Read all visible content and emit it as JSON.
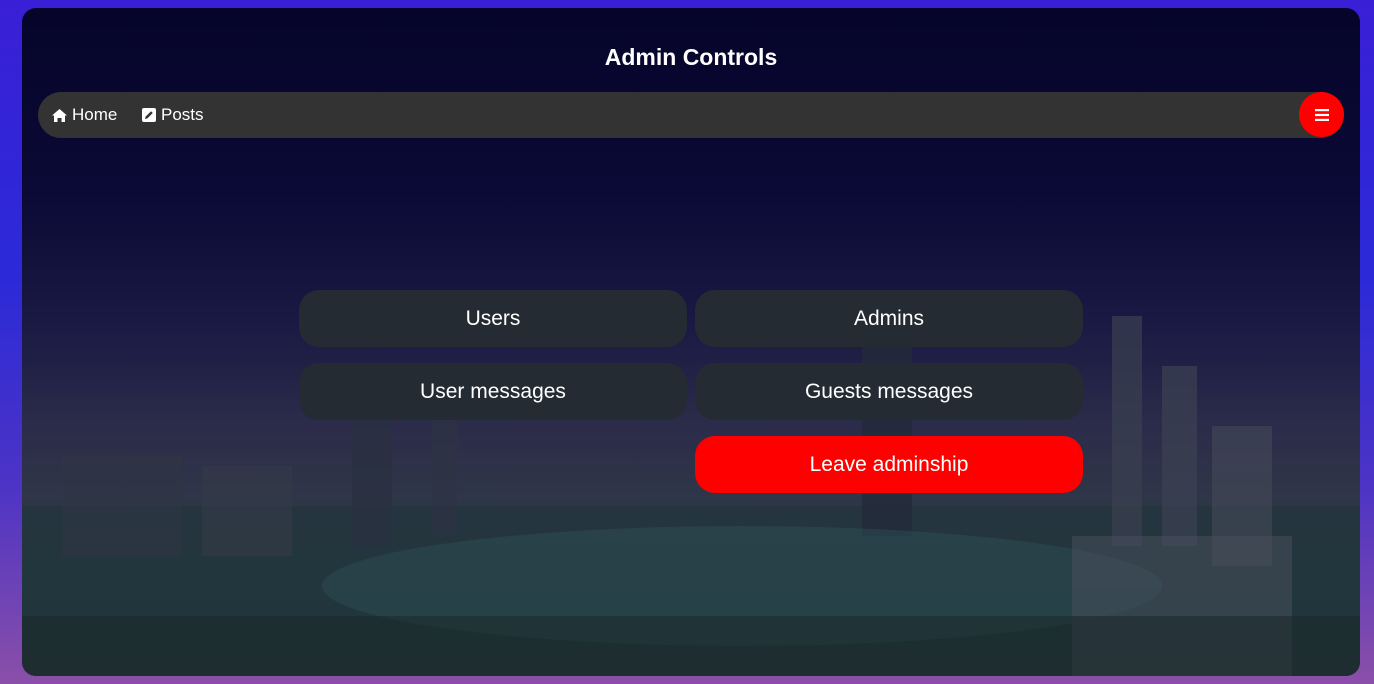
{
  "page": {
    "title": "Admin Controls"
  },
  "navbar": {
    "items": [
      {
        "label": "Home",
        "icon": "home-icon"
      },
      {
        "label": "Posts",
        "icon": "edit-icon"
      }
    ],
    "menu_button_icon": "hamburger-menu-icon"
  },
  "actions": {
    "users_label": "Users",
    "admins_label": "Admins",
    "user_messages_label": "User messages",
    "guests_messages_label": "Guests messages",
    "leave_adminship_label": "Leave adminship"
  },
  "colors": {
    "accent": "#ff0000",
    "navbar_bg": "#333333",
    "button_bg": "#242b33",
    "text": "#ffffff"
  }
}
